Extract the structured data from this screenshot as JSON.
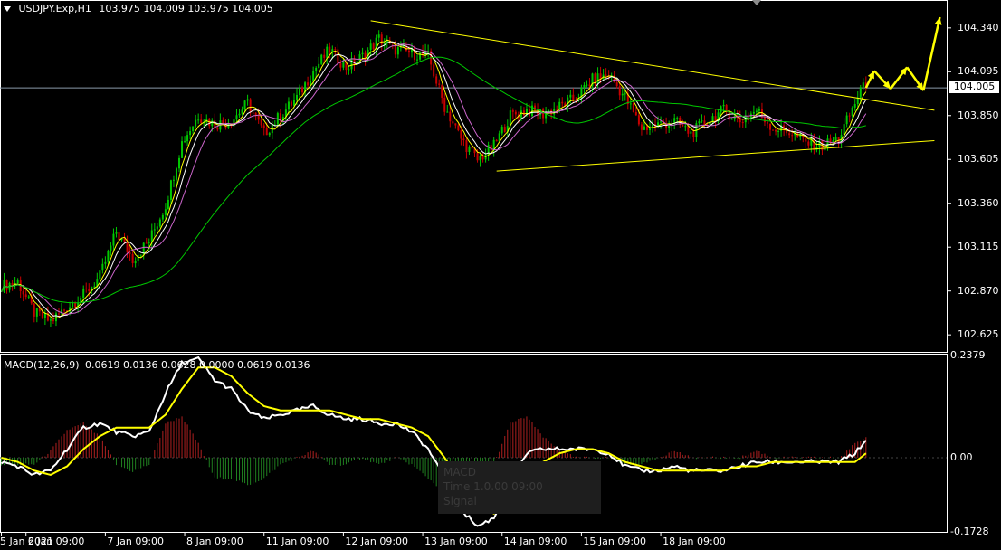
{
  "header": {
    "symbol": "USDJPY.Exp,H1",
    "ohlc": "103.975 104.009 103.975 104.005"
  },
  "macd_header": {
    "label": "MACD(12,26,9)",
    "values": "0.0619 0.0136 0.0628 0.0000 0.0619 0.0136"
  },
  "current_price": "104.005",
  "overlay": {
    "line1": "MACD",
    "line2": "Time 1.0.00 09:00",
    "line3": "Signal"
  },
  "colors": {
    "background": "#000000",
    "axis": "#ffffff",
    "bull": "#00c800",
    "bear": "#c80000",
    "ma_fast": "#ffff00",
    "ma_mid": "#ffffff",
    "ma_slow": "#cc66cc",
    "ma_long": "#00c800",
    "trendline": "#ffff00",
    "macd_line": "#ffffff",
    "signal_line": "#ffff00",
    "hist_pos": "#b02020",
    "hist_neg": "#208020"
  },
  "chart_data": [
    {
      "type": "candlestick",
      "symbol": "USDJPY.Exp",
      "timeframe": "H1",
      "ylim": [
        102.55,
        104.42
      ],
      "y_ticks": [
        "104.340",
        "104.095",
        "103.850",
        "103.605",
        "103.360",
        "103.115",
        "102.870",
        "102.625"
      ],
      "x_ticks": [
        "5 Jan 2021",
        "6 Jan 09:00",
        "7 Jan 09:00",
        "8 Jan 09:00",
        "11 Jan 09:00",
        "12 Jan 09:00",
        "13 Jan 09:00",
        "14 Jan 09:00",
        "15 Jan 09:00",
        "18 Jan 09:00"
      ],
      "close_path": [
        [
          0,
          102.9
        ],
        [
          6,
          102.92
        ],
        [
          12,
          102.75
        ],
        [
          18,
          102.7
        ],
        [
          24,
          102.78
        ],
        [
          30,
          102.85
        ],
        [
          36,
          102.95
        ],
        [
          42,
          103.2
        ],
        [
          48,
          103.05
        ],
        [
          54,
          103.15
        ],
        [
          60,
          103.35
        ],
        [
          66,
          103.7
        ],
        [
          72,
          103.85
        ],
        [
          78,
          103.8
        ],
        [
          84,
          103.82
        ],
        [
          90,
          103.92
        ],
        [
          96,
          103.75
        ],
        [
          102,
          103.85
        ],
        [
          108,
          103.95
        ],
        [
          114,
          104.1
        ],
        [
          120,
          104.22
        ],
        [
          126,
          104.12
        ],
        [
          132,
          104.18
        ],
        [
          138,
          104.28
        ],
        [
          144,
          104.22
        ],
        [
          150,
          104.2
        ],
        [
          156,
          104.18
        ],
        [
          162,
          103.9
        ],
        [
          168,
          103.72
        ],
        [
          174,
          103.6
        ],
        [
          180,
          103.68
        ],
        [
          186,
          103.85
        ],
        [
          192,
          103.88
        ],
        [
          198,
          103.86
        ],
        [
          204,
          103.9
        ],
        [
          210,
          103.95
        ],
        [
          216,
          104.05
        ],
        [
          222,
          104.08
        ],
        [
          228,
          103.95
        ],
        [
          234,
          103.78
        ],
        [
          240,
          103.8
        ],
        [
          246,
          103.82
        ],
        [
          252,
          103.75
        ],
        [
          258,
          103.82
        ],
        [
          264,
          103.88
        ],
        [
          270,
          103.82
        ],
        [
          276,
          103.88
        ],
        [
          282,
          103.78
        ],
        [
          288,
          103.76
        ],
        [
          294,
          103.7
        ],
        [
          300,
          103.68
        ],
        [
          306,
          103.72
        ],
        [
          312,
          103.92
        ],
        [
          314,
          104.0
        ],
        [
          316,
          104.005
        ]
      ],
      "moving_averages": [
        "yellow fast",
        "white mid",
        "violet slow",
        "green long"
      ],
      "trendlines": [
        {
          "from": [
            135,
            104.38
          ],
          "to": [
            341,
            103.88
          ]
        },
        {
          "from": [
            181,
            103.54
          ],
          "to": [
            341,
            103.71
          ]
        }
      ],
      "forecast_arrows": [
        [
          316,
          104.005
        ],
        [
          319,
          104.1
        ],
        [
          325,
          104.0
        ],
        [
          331,
          104.12
        ],
        [
          337,
          103.99
        ],
        [
          343,
          104.4
        ]
      ]
    },
    {
      "type": "line",
      "name": "MACD(12,26,9)",
      "ylim": [
        -0.1728,
        0.2379
      ],
      "y_ticks": [
        "0.2379",
        "0.00",
        "-0.1728"
      ],
      "series": [
        {
          "name": "MACD",
          "color": "#ffffff",
          "values": [
            [
              0,
              -0.01
            ],
            [
              6,
              -0.02
            ],
            [
              12,
              -0.04
            ],
            [
              18,
              -0.03
            ],
            [
              24,
              0.02
            ],
            [
              30,
              0.07
            ],
            [
              36,
              0.08
            ],
            [
              42,
              0.06
            ],
            [
              48,
              0.05
            ],
            [
              54,
              0.06
            ],
            [
              60,
              0.15
            ],
            [
              66,
              0.22
            ],
            [
              72,
              0.23
            ],
            [
              78,
              0.18
            ],
            [
              84,
              0.16
            ],
            [
              90,
              0.11
            ],
            [
              96,
              0.09
            ],
            [
              102,
              0.1
            ],
            [
              108,
              0.11
            ],
            [
              114,
              0.12
            ],
            [
              120,
              0.1
            ],
            [
              126,
              0.09
            ],
            [
              132,
              0.09
            ],
            [
              138,
              0.08
            ],
            [
              144,
              0.08
            ],
            [
              150,
              0.06
            ],
            [
              156,
              0.02
            ],
            [
              162,
              -0.05
            ],
            [
              168,
              -0.12
            ],
            [
              174,
              -0.16
            ],
            [
              180,
              -0.14
            ],
            [
              186,
              -0.06
            ],
            [
              192,
              0.01
            ],
            [
              198,
              0.02
            ],
            [
              204,
              0.02
            ],
            [
              210,
              0.02
            ],
            [
              216,
              0.02
            ],
            [
              222,
              0.01
            ],
            [
              228,
              -0.02
            ],
            [
              234,
              -0.03
            ],
            [
              240,
              -0.03
            ],
            [
              246,
              -0.02
            ],
            [
              252,
              -0.03
            ],
            [
              258,
              -0.03
            ],
            [
              264,
              -0.03
            ],
            [
              270,
              -0.02
            ],
            [
              276,
              -0.01
            ],
            [
              282,
              -0.01
            ],
            [
              288,
              -0.01
            ],
            [
              294,
              -0.01
            ],
            [
              300,
              -0.01
            ],
            [
              306,
              -0.01
            ],
            [
              312,
              0.01
            ],
            [
              316,
              0.04
            ]
          ]
        },
        {
          "name": "Signal",
          "color": "#ffff00",
          "values": [
            [
              0,
              0.0
            ],
            [
              6,
              -0.01
            ],
            [
              12,
              -0.03
            ],
            [
              18,
              -0.04
            ],
            [
              24,
              -0.02
            ],
            [
              30,
              0.02
            ],
            [
              36,
              0.05
            ],
            [
              42,
              0.07
            ],
            [
              48,
              0.07
            ],
            [
              54,
              0.07
            ],
            [
              60,
              0.1
            ],
            [
              66,
              0.16
            ],
            [
              72,
              0.21
            ],
            [
              78,
              0.21
            ],
            [
              84,
              0.19
            ],
            [
              90,
              0.15
            ],
            [
              96,
              0.12
            ],
            [
              102,
              0.11
            ],
            [
              108,
              0.11
            ],
            [
              114,
              0.11
            ],
            [
              120,
              0.11
            ],
            [
              126,
              0.1
            ],
            [
              132,
              0.09
            ],
            [
              138,
              0.09
            ],
            [
              144,
              0.08
            ],
            [
              150,
              0.07
            ],
            [
              156,
              0.05
            ],
            [
              162,
              0.0
            ],
            [
              168,
              -0.06
            ],
            [
              174,
              -0.11
            ],
            [
              180,
              -0.13
            ],
            [
              186,
              -0.11
            ],
            [
              192,
              -0.05
            ],
            [
              198,
              -0.01
            ],
            [
              204,
              0.01
            ],
            [
              210,
              0.02
            ],
            [
              216,
              0.02
            ],
            [
              222,
              0.01
            ],
            [
              228,
              -0.01
            ],
            [
              234,
              -0.02
            ],
            [
              240,
              -0.03
            ],
            [
              246,
              -0.03
            ],
            [
              252,
              -0.03
            ],
            [
              258,
              -0.03
            ],
            [
              264,
              -0.03
            ],
            [
              270,
              -0.02
            ],
            [
              276,
              -0.02
            ],
            [
              282,
              -0.01
            ],
            [
              288,
              -0.01
            ],
            [
              294,
              -0.01
            ],
            [
              300,
              -0.01
            ],
            [
              306,
              -0.01
            ],
            [
              312,
              -0.01
            ],
            [
              316,
              0.01
            ]
          ]
        }
      ]
    }
  ]
}
